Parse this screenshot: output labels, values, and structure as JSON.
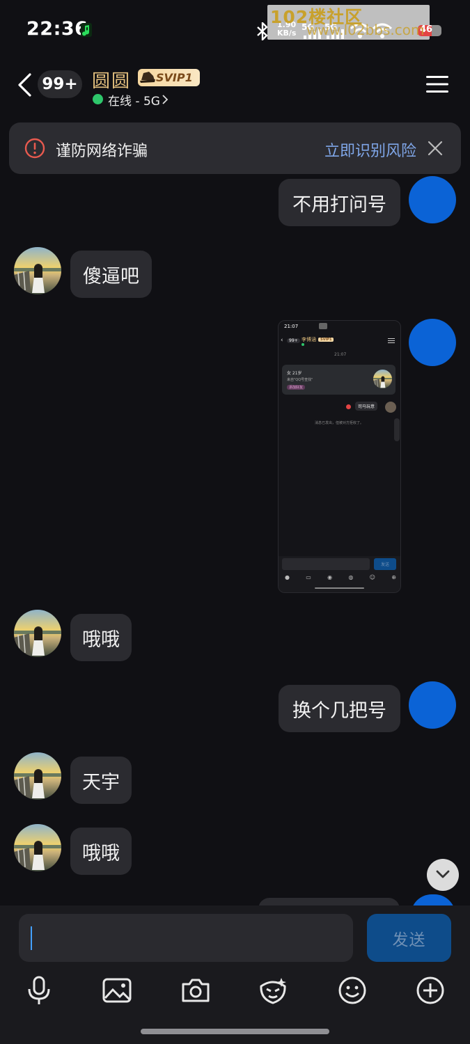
{
  "status_bar": {
    "time": "22:36",
    "net_speed": "1.90",
    "net_unit": "KB/s",
    "net1": "5G",
    "net2": "5G",
    "battery": "46"
  },
  "watermark": {
    "text": "102楼社区",
    "sub": "www.l02bbs.com"
  },
  "header": {
    "unread_count": "99+",
    "contact_name": "圆圆",
    "vip_label": "SVIP1",
    "status": "在线 - 5G"
  },
  "banner": {
    "warning": "谨防网络诈骗",
    "action": "立即识别风险"
  },
  "messages": [
    {
      "side": "right",
      "text": "不用打问号"
    },
    {
      "side": "left",
      "text": "傻逼吧"
    },
    {
      "side": "right",
      "type": "image"
    },
    {
      "side": "left",
      "text": "哦哦"
    },
    {
      "side": "right",
      "text": "换个几把号"
    },
    {
      "side": "left",
      "text": "天宇"
    },
    {
      "side": "left",
      "text": "哦哦"
    }
  ],
  "shot": {
    "time": "21:07",
    "unread": "99+",
    "name": "李博涵",
    "vip": "SVIP1",
    "timestamp": "21:07",
    "card_line1": "女  21岁",
    "card_line2": "来自\"QQ号查找\"",
    "card_tag": "添加好友",
    "bubble": "司马玩意",
    "notice": "消息已发出，但被对方拒收了。",
    "send": "发送"
  },
  "composer": {
    "placeholder": "",
    "send_label": "发送"
  },
  "colors": {
    "accent": "#0b63d6",
    "online": "#2ec66b",
    "link": "#7fa6e8",
    "name": "#e4c07e"
  }
}
